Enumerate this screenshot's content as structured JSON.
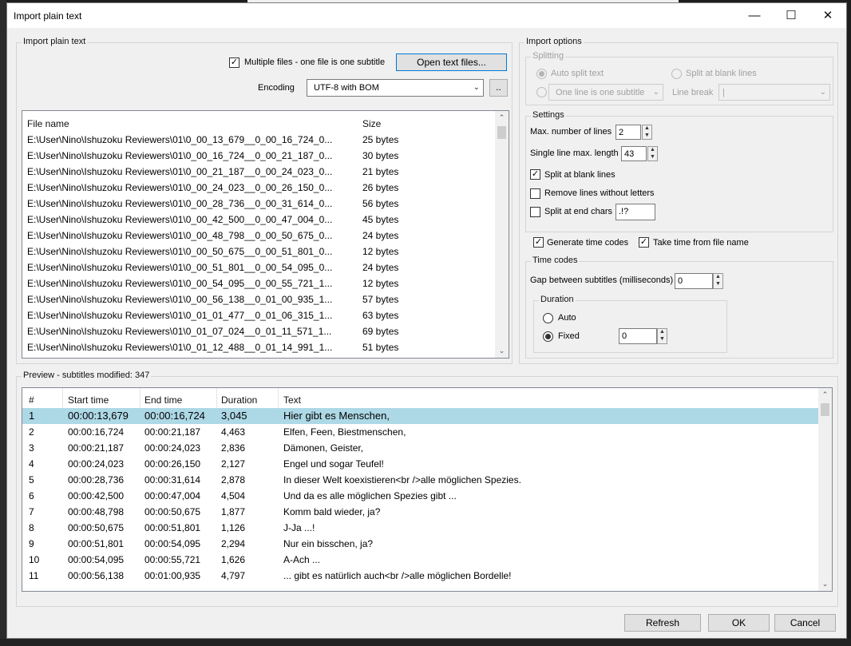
{
  "window": {
    "title": "Import plain text",
    "minimize": "—",
    "maximize": "☐",
    "close": "✕"
  },
  "import_group": {
    "label": "Import plain text",
    "multiple_files_label": "Multiple files - one file is one subtitle",
    "multiple_files_checked": true,
    "open_files_button": "Open text files...",
    "encoding_label": "Encoding",
    "encoding_value": "UTF-8 with BOM",
    "browse_button": "..",
    "columns": [
      "File name",
      "Size"
    ],
    "files": [
      {
        "name": "E:\\User\\Nino\\Ishuzoku Reviewers\\01\\0_00_13_679__0_00_16_724_0...",
        "size": "25 bytes"
      },
      {
        "name": "E:\\User\\Nino\\Ishuzoku Reviewers\\01\\0_00_16_724__0_00_21_187_0...",
        "size": "30 bytes"
      },
      {
        "name": "E:\\User\\Nino\\Ishuzoku Reviewers\\01\\0_00_21_187__0_00_24_023_0...",
        "size": "21 bytes"
      },
      {
        "name": "E:\\User\\Nino\\Ishuzoku Reviewers\\01\\0_00_24_023__0_00_26_150_0...",
        "size": "26 bytes"
      },
      {
        "name": "E:\\User\\Nino\\Ishuzoku Reviewers\\01\\0_00_28_736__0_00_31_614_0...",
        "size": "56 bytes"
      },
      {
        "name": "E:\\User\\Nino\\Ishuzoku Reviewers\\01\\0_00_42_500__0_00_47_004_0...",
        "size": "45 bytes"
      },
      {
        "name": "E:\\User\\Nino\\Ishuzoku Reviewers\\01\\0_00_48_798__0_00_50_675_0...",
        "size": "24 bytes"
      },
      {
        "name": "E:\\User\\Nino\\Ishuzoku Reviewers\\01\\0_00_50_675__0_00_51_801_0...",
        "size": "12 bytes"
      },
      {
        "name": "E:\\User\\Nino\\Ishuzoku Reviewers\\01\\0_00_51_801__0_00_54_095_0...",
        "size": "24 bytes"
      },
      {
        "name": "E:\\User\\Nino\\Ishuzoku Reviewers\\01\\0_00_54_095__0_00_55_721_1...",
        "size": "12 bytes"
      },
      {
        "name": "E:\\User\\Nino\\Ishuzoku Reviewers\\01\\0_00_56_138__0_01_00_935_1...",
        "size": "57 bytes"
      },
      {
        "name": "E:\\User\\Nino\\Ishuzoku Reviewers\\01\\0_01_01_477__0_01_06_315_1...",
        "size": "63 bytes"
      },
      {
        "name": "E:\\User\\Nino\\Ishuzoku Reviewers\\01\\0_01_07_024__0_01_11_571_1...",
        "size": "69 bytes"
      },
      {
        "name": "E:\\User\\Nino\\Ishuzoku Reviewers\\01\\0_01_12_488__0_01_14_991_1...",
        "size": "51 bytes"
      }
    ]
  },
  "import_options": {
    "label": "Import options",
    "splitting": {
      "label": "Splitting",
      "auto_split": "Auto split text",
      "split_blank": "Split at blank lines",
      "one_line": "One line is one subtitle",
      "line_break_label": "Line break",
      "line_break_value": "|"
    },
    "settings": {
      "label": "Settings",
      "max_lines_label": "Max. number of lines",
      "max_lines_value": "2",
      "max_len_label": "Single line max. length",
      "max_len_value": "43",
      "split_blank_label": "Split at blank lines",
      "split_blank_checked": true,
      "remove_lines_label": "Remove lines without letters",
      "remove_lines_checked": false,
      "split_end_label": "Split at end chars",
      "split_end_checked": false,
      "end_chars_value": ".!?"
    },
    "generate_tc_label": "Generate time codes",
    "generate_tc_checked": true,
    "take_time_label": "Take time from file name",
    "take_time_checked": true,
    "time_codes": {
      "label": "Time codes",
      "gap_label": "Gap between subtitles (milliseconds)",
      "gap_value": "0",
      "duration": {
        "label": "Duration",
        "auto": "Auto",
        "fixed": "Fixed",
        "selected": "fixed",
        "fixed_value": "0"
      }
    }
  },
  "preview": {
    "label": "Preview - subtitles modified: 347",
    "columns": [
      "#",
      "Start time",
      "End time",
      "Duration",
      "Text"
    ],
    "rows": [
      [
        "1",
        "00:00:13,679",
        "00:00:16,724",
        "3,045",
        "Hier gibt es Menschen,"
      ],
      [
        "2",
        "00:00:16,724",
        "00:00:21,187",
        "4,463",
        "Elfen, Feen, Biestmenschen,"
      ],
      [
        "3",
        "00:00:21,187",
        "00:00:24,023",
        "2,836",
        "Dämonen, Geister,"
      ],
      [
        "4",
        "00:00:24,023",
        "00:00:26,150",
        "2,127",
        "Engel und sogar Teufel!"
      ],
      [
        "5",
        "00:00:28,736",
        "00:00:31,614",
        "2,878",
        "In dieser Welt koexistieren<br />alle möglichen Spezies."
      ],
      [
        "6",
        "00:00:42,500",
        "00:00:47,004",
        "4,504",
        "Und da es alle möglichen Spezies gibt ..."
      ],
      [
        "7",
        "00:00:48,798",
        "00:00:50,675",
        "1,877",
        "Komm bald wieder, ja?"
      ],
      [
        "8",
        "00:00:50,675",
        "00:00:51,801",
        "1,126",
        "J-Ja ...!"
      ],
      [
        "9",
        "00:00:51,801",
        "00:00:54,095",
        "2,294",
        "Nur ein bisschen, ja?"
      ],
      [
        "10",
        "00:00:54,095",
        "00:00:55,721",
        "1,626",
        "A-Ach ..."
      ],
      [
        "11",
        "00:00:56,138",
        "00:01:00,935",
        "4,797",
        "... gibt es natürlich auch<br />alle möglichen Bordelle!"
      ]
    ],
    "selected_row": 0
  },
  "footer": {
    "refresh": "Refresh",
    "ok": "OK",
    "cancel": "Cancel"
  },
  "colors": {
    "selection": "#add8e6",
    "accent": "#0078d7"
  }
}
